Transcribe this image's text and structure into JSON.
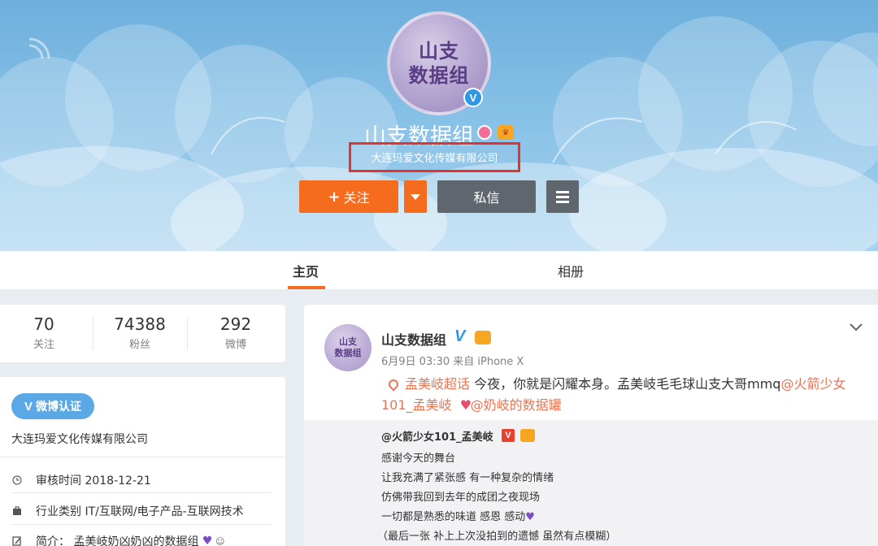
{
  "profile": {
    "avatar_text_line1": "山支",
    "avatar_text_line2": "数据组",
    "verified_mark": "V",
    "name": "山支数据组",
    "verification": "大连玛爱文化传媒有限公司",
    "icons": [
      "rss-icon",
      "verified-v-icon",
      "pink-ribbon-icon",
      "crown-badge-icon"
    ]
  },
  "actions": {
    "follow_label": "关注",
    "follow_plus": "+",
    "message_label": "私信"
  },
  "tabs": [
    {
      "label": "主页",
      "active": true
    },
    {
      "label": "相册",
      "active": false
    }
  ],
  "counts": [
    {
      "value": "70",
      "label": "关注"
    },
    {
      "value": "74388",
      "label": "粉丝"
    },
    {
      "value": "292",
      "label": "微博"
    }
  ],
  "info": {
    "badge_v": "V",
    "badge_label": "微博认证",
    "company": "大连玛爱文化传媒有限公司",
    "rows": [
      {
        "icon": "clock-icon",
        "text": "审核时间 2018-12-21"
      },
      {
        "icon": "briefcase-icon",
        "text": "行业类别 IT/互联网/电子产品-互联网技术"
      },
      {
        "icon": "pen-icon",
        "text": "简介：  孟美岐奶凶奶凶的数据组"
      }
    ]
  },
  "post": {
    "avatar_text_line1": "山支",
    "avatar_text_line2": "数据组",
    "author": "山支数据组",
    "author_v": "V",
    "meta": "6月9日 03:30 来自 iPhone X",
    "topic": "孟美岐超话",
    "text_part1": " 今夜，你就是闪耀本身。孟美岐毛毛球山支大哥mmq",
    "mention1_a": "@火箭少女",
    "mention1_b": "101_孟美岐",
    "mention2": "@奶岐的数据罐"
  },
  "repost": {
    "author": "@火箭少女101_孟美岐",
    "badge": "V",
    "lines": [
      "感谢今天的舞台",
      "让我充满了紧张感 有一种复杂的情绪",
      "仿佛带我回到去年的成团之夜现场",
      "一切都是熟悉的味道 感恩 感动",
      "（最后一张 补上上次没拍到的遗憾 虽然有点模糊）"
    ]
  },
  "colors": {
    "accent_orange": "#f56c1f",
    "link_orange": "#eb7350",
    "weibo_blue": "#2e97e6",
    "dark_button": "#5f666d",
    "highlight_red": "#e5322d"
  }
}
